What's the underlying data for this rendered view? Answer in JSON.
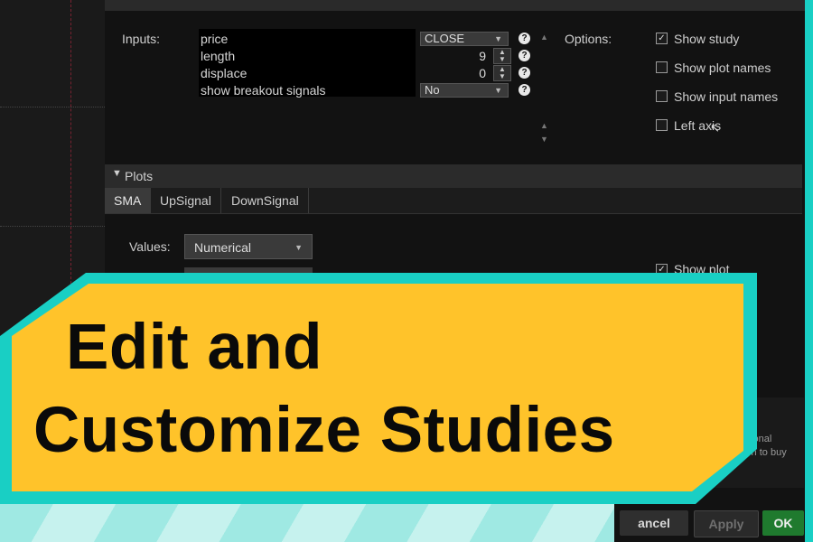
{
  "dialog": {
    "inputs_label": "Inputs:",
    "options_label": "Options:",
    "inputs": [
      {
        "name": "price",
        "value": "CLOSE",
        "kind": "select"
      },
      {
        "name": "length",
        "value": "9",
        "kind": "number"
      },
      {
        "name": "displace",
        "value": "0",
        "kind": "number"
      },
      {
        "name": "show breakout signals",
        "value": "No",
        "kind": "select"
      }
    ],
    "options": [
      {
        "label": "Show study",
        "checked": true
      },
      {
        "label": "Show plot names",
        "checked": false
      },
      {
        "label": "Show input names",
        "checked": false
      },
      {
        "label": "Left axis",
        "checked": false
      }
    ],
    "plots_header": "Plots",
    "plot_tabs": [
      "SMA",
      "UpSignal",
      "DownSignal"
    ],
    "active_plot_tab": "SMA",
    "values_label": "Values:",
    "values_select": "Numerical",
    "show_plot": "Show plot",
    "notice_lines": [
      "tional",
      "ssion to buy"
    ],
    "buttons": {
      "cancel": "ancel",
      "apply": "Apply",
      "ok": "OK"
    }
  },
  "banner": {
    "line1": "Edit and",
    "line2": "Customize Studies"
  },
  "colors": {
    "frame": "#19cfc4",
    "banner": "#ffc32a",
    "ok_button": "#1f7a2e",
    "dialog_bg": "#121212"
  }
}
